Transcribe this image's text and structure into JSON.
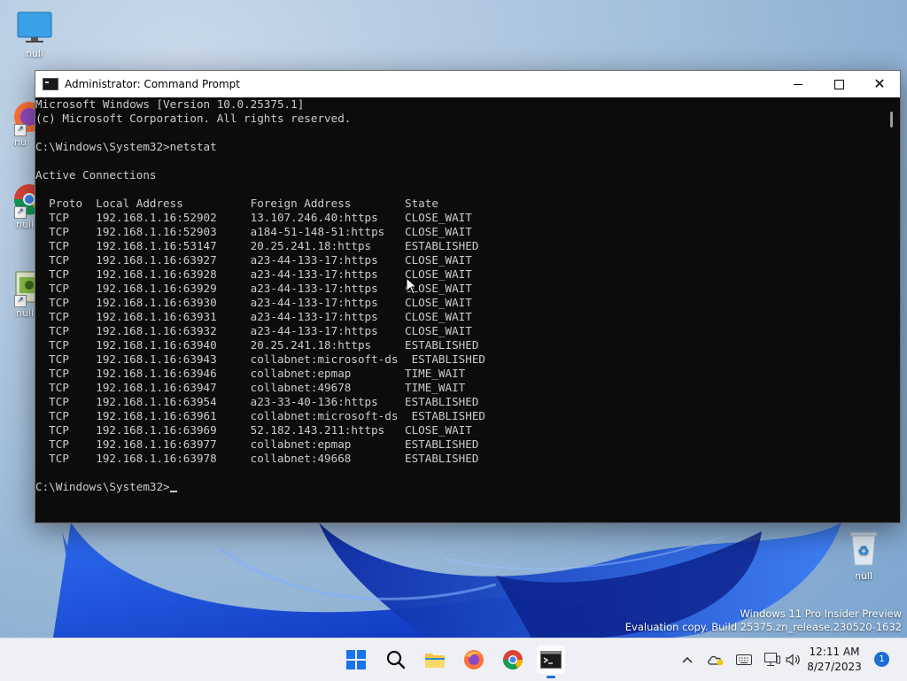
{
  "desktop": {
    "icons": [
      {
        "label": "null",
        "kind": "this-pc"
      },
      {
        "label": "nu",
        "kind": "firefox"
      },
      {
        "label": "null",
        "kind": "chrome"
      },
      {
        "label": "null",
        "kind": "app"
      },
      {
        "label": "null",
        "kind": "recycle-bin"
      }
    ]
  },
  "window": {
    "title": "Administrator: Command Prompt",
    "console_text": "Microsoft Windows [Version 10.0.25375.1]\n(c) Microsoft Corporation. All rights reserved.\n\nC:\\Windows\\System32>netstat\n\nActive Connections\n\n  Proto  Local Address          Foreign Address        State\n  TCP    192.168.1.16:52902     13.107.246.40:https    CLOSE_WAIT\n  TCP    192.168.1.16:52903     a184-51-148-51:https   CLOSE_WAIT\n  TCP    192.168.1.16:53147     20.25.241.18:https     ESTABLISHED\n  TCP    192.168.1.16:63927     a23-44-133-17:https    CLOSE_WAIT\n  TCP    192.168.1.16:63928     a23-44-133-17:https    CLOSE_WAIT\n  TCP    192.168.1.16:63929     a23-44-133-17:https    CLOSE_WAIT\n  TCP    192.168.1.16:63930     a23-44-133-17:https    CLOSE_WAIT\n  TCP    192.168.1.16:63931     a23-44-133-17:https    CLOSE_WAIT\n  TCP    192.168.1.16:63932     a23-44-133-17:https    CLOSE_WAIT\n  TCP    192.168.1.16:63940     20.25.241.18:https     ESTABLISHED\n  TCP    192.168.1.16:63943     collabnet:microsoft-ds  ESTABLISHED\n  TCP    192.168.1.16:63946     collabnet:epmap        TIME_WAIT\n  TCP    192.168.1.16:63947     collabnet:49678        TIME_WAIT\n  TCP    192.168.1.16:63954     a23-33-40-136:https    ESTABLISHED\n  TCP    192.168.1.16:63961     collabnet:microsoft-ds  ESTABLISHED\n  TCP    192.168.1.16:63969     52.182.143.211:https   CLOSE_WAIT\n  TCP    192.168.1.16:63977     collabnet:epmap        ESTABLISHED\n  TCP    192.168.1.16:63978     collabnet:49668        ESTABLISHED\n\nC:\\Windows\\System32>"
  },
  "watermark": {
    "line1": "Windows 11 Pro Insider Preview",
    "line2": "Evaluation copy. Build 25375.zn_release.230520-1632"
  },
  "taskbar": {
    "apps": [
      "start-icon",
      "search-icon",
      "file-explorer-icon",
      "firefox-icon",
      "chrome-icon",
      "command-prompt-icon"
    ],
    "clock_time": "12:11 AM",
    "clock_date": "8/27/2023",
    "notification_count": "1"
  },
  "colors": {
    "accent": "#1a6fd1",
    "console_bg": "#0c0c0c",
    "console_fg": "#cccccc"
  }
}
